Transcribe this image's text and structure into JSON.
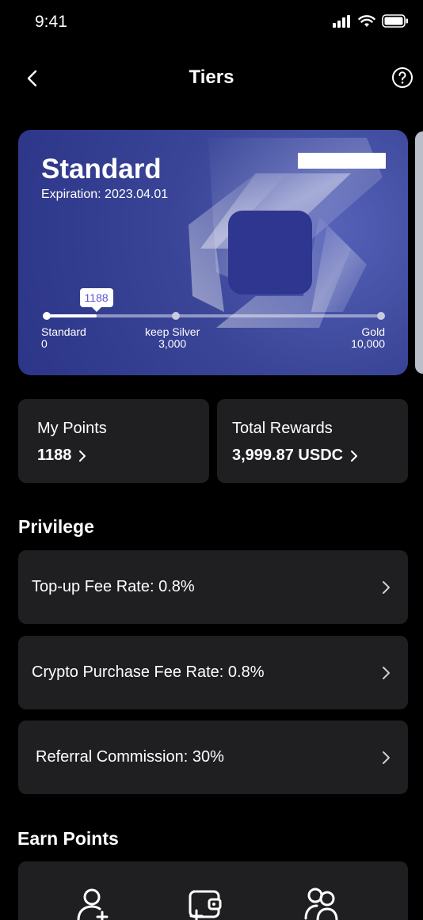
{
  "status_bar": {
    "time": "9:41"
  },
  "nav": {
    "title": "Tiers"
  },
  "tier_card": {
    "name": "Standard",
    "expiration": "Expiration: 2023.04.01",
    "current_points_badge": "1188",
    "progress_fraction": 0.1188,
    "milestones": [
      {
        "name": "Standard",
        "points": "0"
      },
      {
        "name": "keep Silver",
        "points": "3,000"
      },
      {
        "name": "Gold",
        "points": "10,000"
      }
    ]
  },
  "stats": {
    "my_points_label": "My Points",
    "my_points_value": "1188",
    "total_rewards_label": "Total Rewards",
    "total_rewards_value": "3,999.87 USDC"
  },
  "privilege": {
    "title": "Privilege",
    "items": [
      {
        "label": "Top-up Fee Rate: 0.8%"
      },
      {
        "label": "Crypto Purchase Fee Rate: 0.8%"
      },
      {
        "label": "Referral Commission: 30%"
      }
    ]
  },
  "earn_points": {
    "title": "Earn Points",
    "icons": [
      "add-user-icon",
      "wallet-add-icon",
      "users-exchange-icon"
    ]
  },
  "colors": {
    "background": "#000000",
    "card_surface": "#1f1f21",
    "tier_card": "#3a4597",
    "badge_text": "#5a57d6"
  }
}
